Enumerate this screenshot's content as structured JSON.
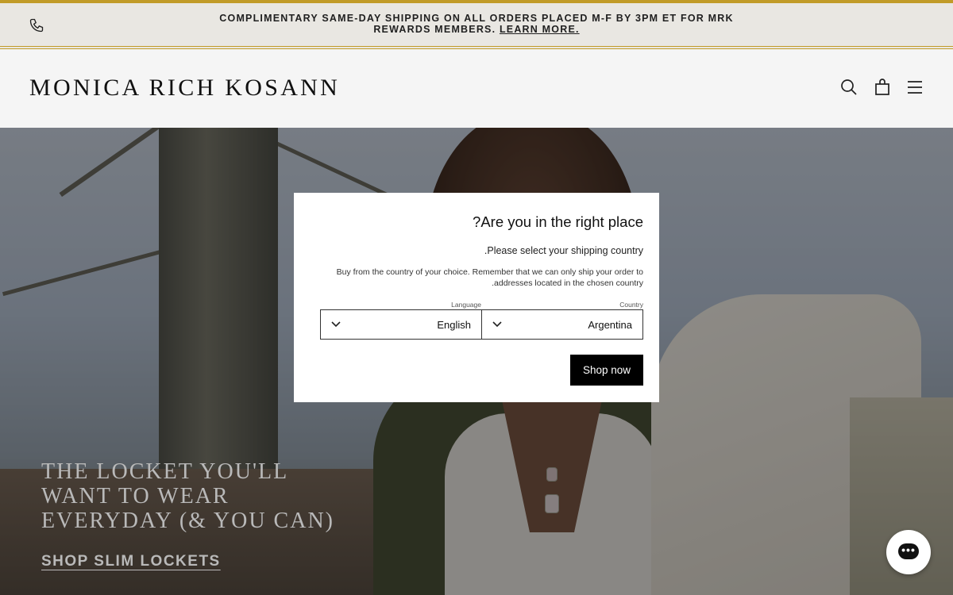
{
  "announcement": {
    "line1": "COMPLIMENTARY SAME-DAY SHIPPING ON ALL ORDERS PLACED M-F BY 3PM ET FOR MRK",
    "line2_prefix": "REWARDS MEMBERS.",
    "learn_more": "LEARN MORE.",
    "phone_icon": "phone-icon"
  },
  "header": {
    "logo": "MONICA RICH KOSANN",
    "icons": [
      "search-icon",
      "bag-icon",
      "menu-icon"
    ]
  },
  "hero": {
    "headline_lines": [
      "THE LOCKET YOU'LL",
      "WANT TO WEAR",
      "EVERYDAY (& YOU CAN)"
    ],
    "cta": "SHOP SLIM LOCKETS"
  },
  "modal": {
    "title": "Are you in the right place?",
    "subtitle": "Please select your shipping country.",
    "description": "Buy from the country of your choice. Remember that we can only ship your order to addresses located in the chosen country.",
    "language_label": "Language",
    "language_value": "English",
    "country_label": "Country",
    "country_value": "Argentina",
    "button": "Shop now"
  },
  "chat": {
    "icon": "chat-icon",
    "text": "•••"
  },
  "colors": {
    "accent_gold": "#c9a22a",
    "button_black": "#000000"
  }
}
